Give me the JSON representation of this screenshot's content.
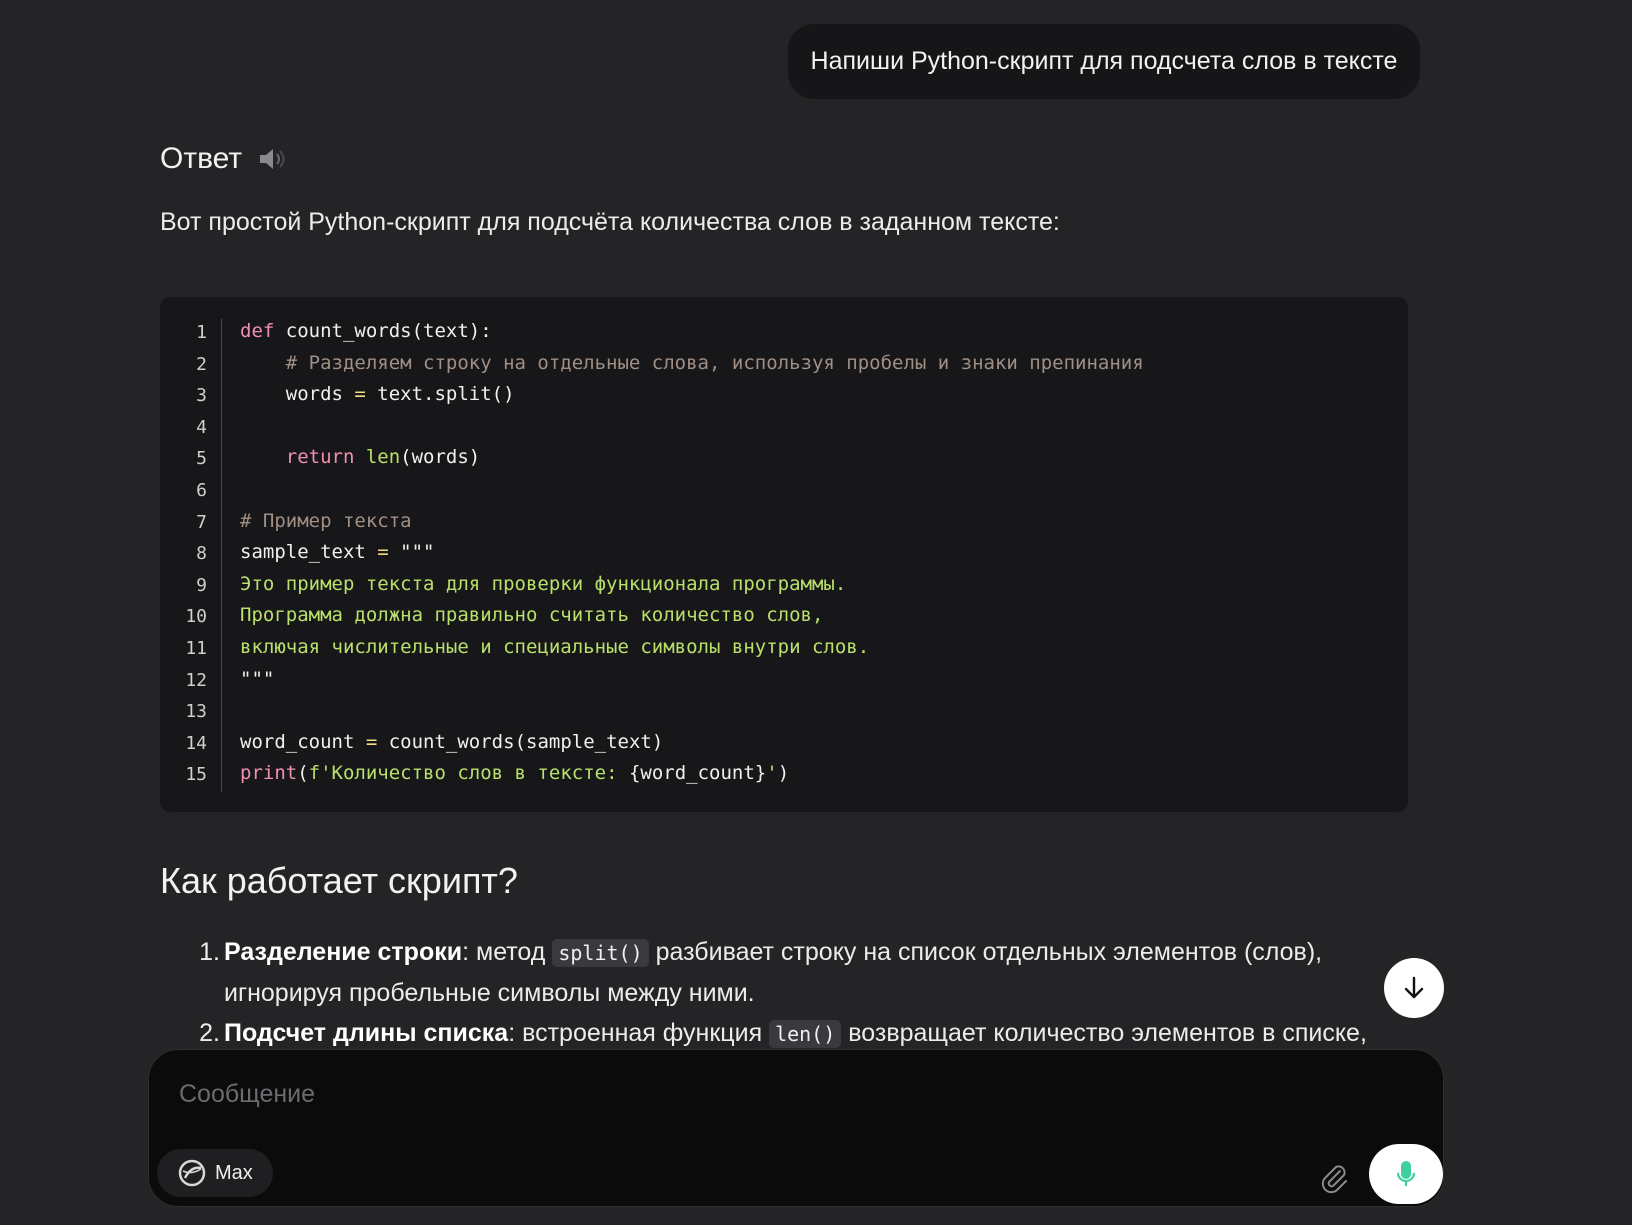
{
  "user_message": "Напиши Python-скрипт для подсчета слов в тексте",
  "answer": {
    "title": "Ответ",
    "intro": "Вот простой Python-скрипт для подсчёта количества слов в заданном тексте:"
  },
  "code": {
    "line_numbers": [
      "1",
      "2",
      "3",
      "4",
      "5",
      "6",
      "7",
      "8",
      "9",
      "10",
      "11",
      "12",
      "13",
      "14",
      "15"
    ],
    "l1_kw": "def",
    "l1_rest": " count_words(text):",
    "l2": "    # Разделяем строку на отдельные слова, используя пробелы и знаки препинания",
    "l3_a": "    words ",
    "l3_op": "=",
    "l3_b": " text.split()",
    "l5_kw": "    return",
    "l5_bi": " len",
    "l5_rest": "(words)",
    "l7": "# Пример текста",
    "l8_a": "sample_text ",
    "l8_op": "=",
    "l8_str": " \"\"\"",
    "l9": "Это пример текста для проверки функционала программы.",
    "l10": "Программа должна правильно считать количество слов,",
    "l11": "включая числительные и специальные символы внутри слов.",
    "l12": "\"\"\"",
    "l14_a": "word_count ",
    "l14_op": "=",
    "l14_b": " count_words(sample_text)",
    "l15_kw": "print",
    "l15_p": "(",
    "l15_str": "f'Количество слов в тексте: ",
    "l15_var": "{word_count}",
    "l15_end_str": "'",
    "l15_close": ")"
  },
  "section": {
    "heading": "Как работает скрипт?",
    "steps": [
      {
        "num": "1.",
        "bold": "Разделение строки",
        "pre": ": метод ",
        "code": "split()",
        "post": " разбивает строку на список отдельных элементов (слов), игнорируя пробельные символы между ними."
      },
      {
        "num": "2.",
        "bold": "Подсчет длины списка",
        "pre": ": встроенная функция ",
        "code": "len()",
        "post": " возвращает количество элементов в списке,"
      }
    ]
  },
  "composer": {
    "placeholder": "Сообщение",
    "model_label": "Max"
  },
  "icons": {
    "speaker": "speaker-icon",
    "scroll_down": "arrow-down-icon",
    "attach": "paperclip-icon",
    "mic": "microphone-icon",
    "model_logo": "gigachat-logo-icon"
  },
  "colors": {
    "background": "#242427",
    "code_background": "#17171a",
    "mic_accent": "#3ed0a0"
  }
}
